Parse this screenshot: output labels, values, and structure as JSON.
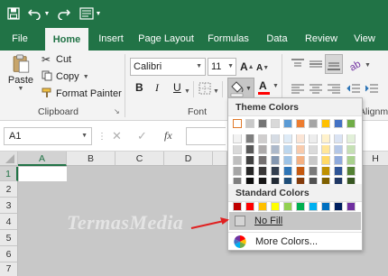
{
  "tabs": [
    {
      "label": "File"
    },
    {
      "label": "Home"
    },
    {
      "label": "Insert"
    },
    {
      "label": "Page Layout"
    },
    {
      "label": "Formulas"
    },
    {
      "label": "Data"
    },
    {
      "label": "Review"
    },
    {
      "label": "View"
    }
  ],
  "ribbon": {
    "paste_label": "Paste",
    "cut_label": "Cut",
    "copy_label": "Copy",
    "format_painter_label": "Format Painter",
    "clipboard_label": "Clipboard",
    "font_name": "Calibri",
    "font_size": "11",
    "font_label": "Font",
    "bold": "B",
    "italic": "I",
    "underline": "U",
    "grow_font": "A",
    "shrink_font": "A",
    "font_color_letter": "A",
    "alignment_label": "Alignm"
  },
  "formula_bar": {
    "name_box": "A1",
    "fx_label": "fx"
  },
  "grid": {
    "columns": [
      "A",
      "B",
      "C",
      "D",
      "H"
    ],
    "rows": [
      "1",
      "2",
      "3",
      "4",
      "5",
      "6",
      "7"
    ]
  },
  "watermark": "TermasMedia",
  "color_menu": {
    "theme_colors_label": "Theme Colors",
    "standard_colors_label": "Standard Colors",
    "no_fill_label": "No Fill",
    "more_colors_label": "More Colors...",
    "theme_colors": [
      [
        "#ffffff",
        "#c9c9c9",
        "#747474",
        "#d9d9d9",
        "#5b9bd5",
        "#ed7d31",
        "#a5a5a5",
        "#ffc000",
        "#4472c4",
        "#70ad47"
      ],
      [
        "#f2f2f2",
        "#7f7f7f",
        "#d0cece",
        "#d6dce4",
        "#deebf7",
        "#fbe5d6",
        "#ededed",
        "#fff2cc",
        "#dae3f3",
        "#e2f0d9"
      ],
      [
        "#d9d9d9",
        "#595959",
        "#aeabab",
        "#adb9ca",
        "#bdd7ee",
        "#f8cbad",
        "#dbdbdb",
        "#ffe699",
        "#b4c7e7",
        "#c5e0b4"
      ],
      [
        "#bfbfbf",
        "#404040",
        "#757171",
        "#8497b0",
        "#9dc3e6",
        "#f4b183",
        "#c9c9c9",
        "#ffd966",
        "#8faadc",
        "#a9d18e"
      ],
      [
        "#a6a6a6",
        "#262626",
        "#3a3838",
        "#333f50",
        "#2e75b6",
        "#c55a11",
        "#7b7b7b",
        "#bf9000",
        "#2f5597",
        "#548235"
      ],
      [
        "#7f7f7f",
        "#0d0d0d",
        "#171616",
        "#222a35",
        "#1f4e79",
        "#843c0c",
        "#525252",
        "#7f6000",
        "#203864",
        "#385723"
      ]
    ],
    "standard_colors": [
      "#c00000",
      "#ff0000",
      "#ffc000",
      "#ffff00",
      "#92d050",
      "#00b050",
      "#00b0f0",
      "#0070c0",
      "#002060",
      "#7030a0"
    ]
  },
  "colors": {
    "excel_green": "#217346",
    "highlight": "#c6c6c6",
    "arrow": "#e02020"
  }
}
